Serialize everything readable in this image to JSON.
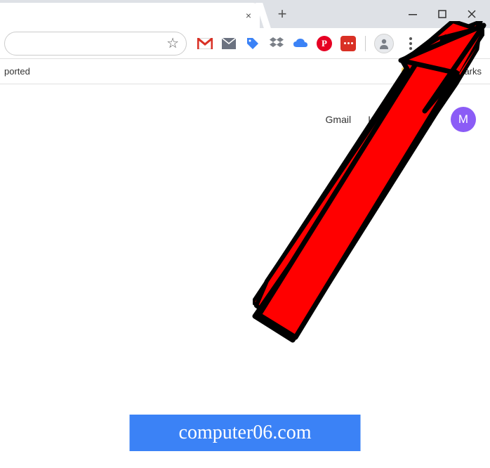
{
  "tabstrip": {
    "close_icon": "×",
    "new_tab_icon": "+"
  },
  "window": {
    "minimize": "—",
    "maximize": "❐",
    "close": "✕"
  },
  "toolbar": {
    "star_icon": "☆"
  },
  "extensions": {
    "gmail": {
      "name": "gmail-icon",
      "color_bar": "#d93025"
    },
    "gmail_checker": {
      "name": "mail-checker-icon",
      "fill": "#6b7280"
    },
    "pricetag": {
      "name": "pricetag-icon",
      "fill": "#3b82f6"
    },
    "dropbox": {
      "name": "dropbox-icon",
      "fill": "#6b7280"
    },
    "cloud": {
      "name": "cloud-icon",
      "fill": "#3b82f6"
    },
    "pinterest": {
      "name": "pinterest-icon",
      "letter": "P",
      "bg": "#e60023"
    },
    "lastpass": {
      "name": "lastpass-icon",
      "bg": "#d93025"
    }
  },
  "bookmarks": {
    "imported_label": "ported",
    "other_bookmarks_label": "arks"
  },
  "ntp": {
    "gmail_label": "Gmail",
    "images_label": "Images",
    "avatar_letter": "M",
    "avatar_bg": "#8b5cf6"
  },
  "watermark": {
    "text": "computer06.com"
  }
}
